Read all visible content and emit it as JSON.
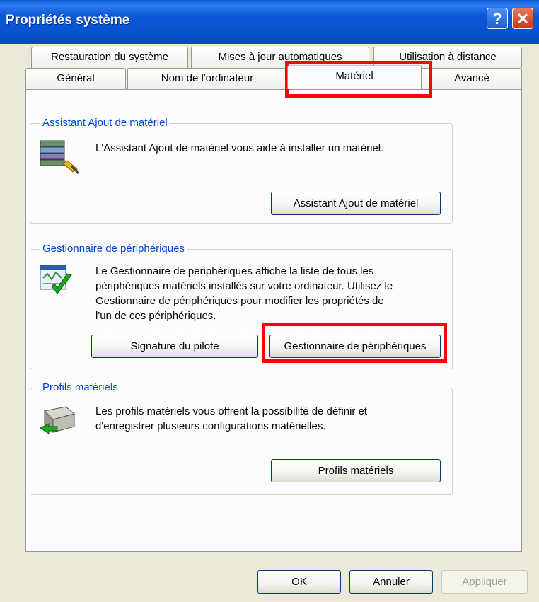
{
  "window": {
    "title": "Propriétés système",
    "help_label": "?",
    "close_label": "✕"
  },
  "tabs": {
    "row1": [
      "Restauration du système",
      "Mises à jour automatiques",
      "Utilisation à distance"
    ],
    "row2": [
      "Général",
      "Nom de l'ordinateur",
      "Matériel",
      "Avancé"
    ],
    "active": "Matériel"
  },
  "groups": {
    "add_hardware": {
      "title": "Assistant Ajout de matériel",
      "text": "L'Assistant Ajout de matériel vous aide à installer un matériel.",
      "button": "Assistant Ajout de matériel",
      "icon": "add-hardware-icon"
    },
    "device_manager": {
      "title": "Gestionnaire de périphériques",
      "text_lines": [
        "Le Gestionnaire de périphériques affiche la liste de tous les",
        "périphériques matériels installés sur votre ordinateur. Utilisez le",
        "Gestionnaire de périphériques pour modifier les propriétés de",
        "l'un de ces périphériques."
      ],
      "button_signature": "Signature du pilote",
      "button_manager": "Gestionnaire de périphériques",
      "icon": "device-manager-icon"
    },
    "profiles": {
      "title": "Profils matériels",
      "text_lines": [
        "Les profils matériels vous offrent la possibilité de définir et",
        "d'enregistrer plusieurs configurations matérielles."
      ],
      "button": "Profils matériels",
      "icon": "hardware-profile-icon"
    }
  },
  "footer": {
    "ok": "OK",
    "cancel": "Annuler",
    "apply": "Appliquer"
  },
  "colors": {
    "highlight": "#ff0000",
    "group_title": "#0046d5",
    "titlebar": "#0853cf"
  }
}
